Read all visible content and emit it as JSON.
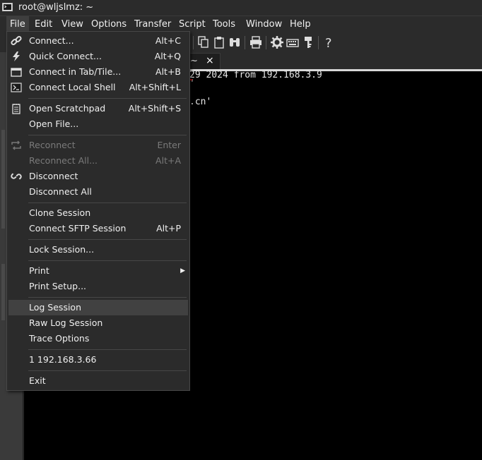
{
  "window": {
    "title": "root@wljslmz: ~"
  },
  "menubar": {
    "items": [
      "File",
      "Edit",
      "View",
      "Options",
      "Transfer",
      "Script",
      "Tools",
      "Window",
      "Help"
    ]
  },
  "tab": {
    "label": "~",
    "close": "×"
  },
  "terminal": {
    "lines": [
      "29 2024 from 192.168.3.9",
      "'",
      ".cn'"
    ]
  },
  "file_menu": {
    "items": [
      {
        "label": "Connect...",
        "shortcut": "Alt+C",
        "icon": "link-icon"
      },
      {
        "label": "Quick Connect...",
        "shortcut": "Alt+Q",
        "icon": "lightning-icon"
      },
      {
        "label": "Connect in Tab/Tile...",
        "shortcut": "Alt+B",
        "icon": "tab-window-icon"
      },
      {
        "label": "Connect Local Shell",
        "shortcut": "Alt+Shift+L",
        "icon": "terminal-icon"
      },
      {
        "label": "Open Scratchpad",
        "shortcut": "Alt+Shift+S",
        "icon": "notepad-icon"
      },
      {
        "label": "Open File...",
        "shortcut": ""
      },
      {
        "label": "Reconnect",
        "shortcut": "Enter",
        "icon": "reconnect-icon",
        "disabled": true
      },
      {
        "label": "Reconnect All...",
        "shortcut": "Alt+A",
        "disabled": true
      },
      {
        "label": "Disconnect",
        "shortcut": "",
        "icon": "broken-link-icon"
      },
      {
        "label": "Disconnect All",
        "shortcut": ""
      },
      {
        "label": "Clone Session",
        "shortcut": ""
      },
      {
        "label": "Connect SFTP Session",
        "shortcut": "Alt+P"
      },
      {
        "label": "Lock Session...",
        "shortcut": ""
      },
      {
        "label": "Print",
        "shortcut": "",
        "submenu": true
      },
      {
        "label": "Print Setup...",
        "shortcut": ""
      },
      {
        "label": "Log Session",
        "shortcut": "",
        "highlighted": true
      },
      {
        "label": "Raw Log Session",
        "shortcut": ""
      },
      {
        "label": "Trace Options",
        "shortcut": ""
      },
      {
        "label": "1 192.168.3.66",
        "shortcut": ""
      },
      {
        "label": "Exit",
        "shortcut": ""
      }
    ]
  },
  "toolbar": {
    "icons": [
      "copy-icon",
      "paste-icon",
      "find-icon",
      "print-icon",
      "gear-icon",
      "keymap-icon",
      "key-icon",
      "help-icon"
    ]
  },
  "colors": {
    "background": "#2b2b2b",
    "terminal": "#000000",
    "highlight": "#414141"
  }
}
